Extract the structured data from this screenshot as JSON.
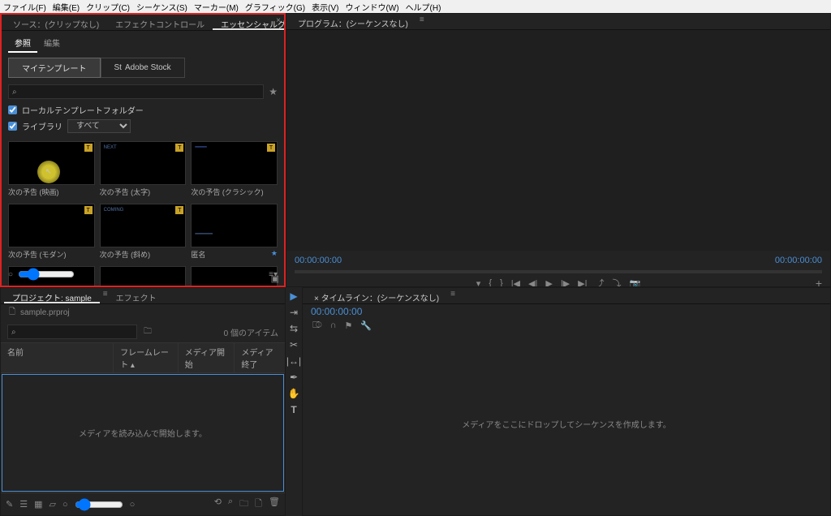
{
  "menu": [
    "ファイル(F)",
    "編集(E)",
    "クリップ(C)",
    "シーケンス(S)",
    "マーカー(M)",
    "グラフィック(G)",
    "表示(V)",
    "ウィンドウ(W)",
    "ヘルプ(H)"
  ],
  "panels": {
    "egfx": {
      "tabs": [
        "ソース：(クリップなし)",
        "エフェクトコントロール",
        "エッセンシャルグラフィックス"
      ],
      "active_tab": 2,
      "subtabs": {
        "browse": "参照",
        "edit": "編集"
      },
      "toggles": {
        "my_templates": "マイテンプレート",
        "adobe_stock": "Adobe Stock"
      },
      "search_placeholder": "",
      "filters": {
        "local_folder": "ローカルテンプレートフォルダー",
        "libraries": "ライブラリ",
        "libraries_value": "すべて"
      },
      "templates": [
        "次の予告 (映画)",
        "次の予告 (太字)",
        "次の予告 (クラシック)",
        "次の予告 (モダン)",
        "次の予告 (斜め)",
        "匿名"
      ]
    },
    "program": {
      "tab_label": "プログラム：(シーケンスなし)",
      "tc_left": "00:00:00:00",
      "tc_right": "00:00:00:00"
    },
    "project": {
      "tabs": [
        "プロジェクト: sample",
        "エフェクト"
      ],
      "file": "sample.prproj",
      "items_count": "0 個のアイテム",
      "columns": [
        "名前",
        "フレームレート",
        "メディア開始",
        "メディア終了"
      ],
      "empty_msg": "メディアを読み込んで開始します。"
    },
    "timeline": {
      "tab_label": "タイムライン：(シーケンスなし)",
      "timecode": "00:00:00:00",
      "empty_msg": "メディアをここにドロップしてシーケンスを作成します。"
    }
  }
}
